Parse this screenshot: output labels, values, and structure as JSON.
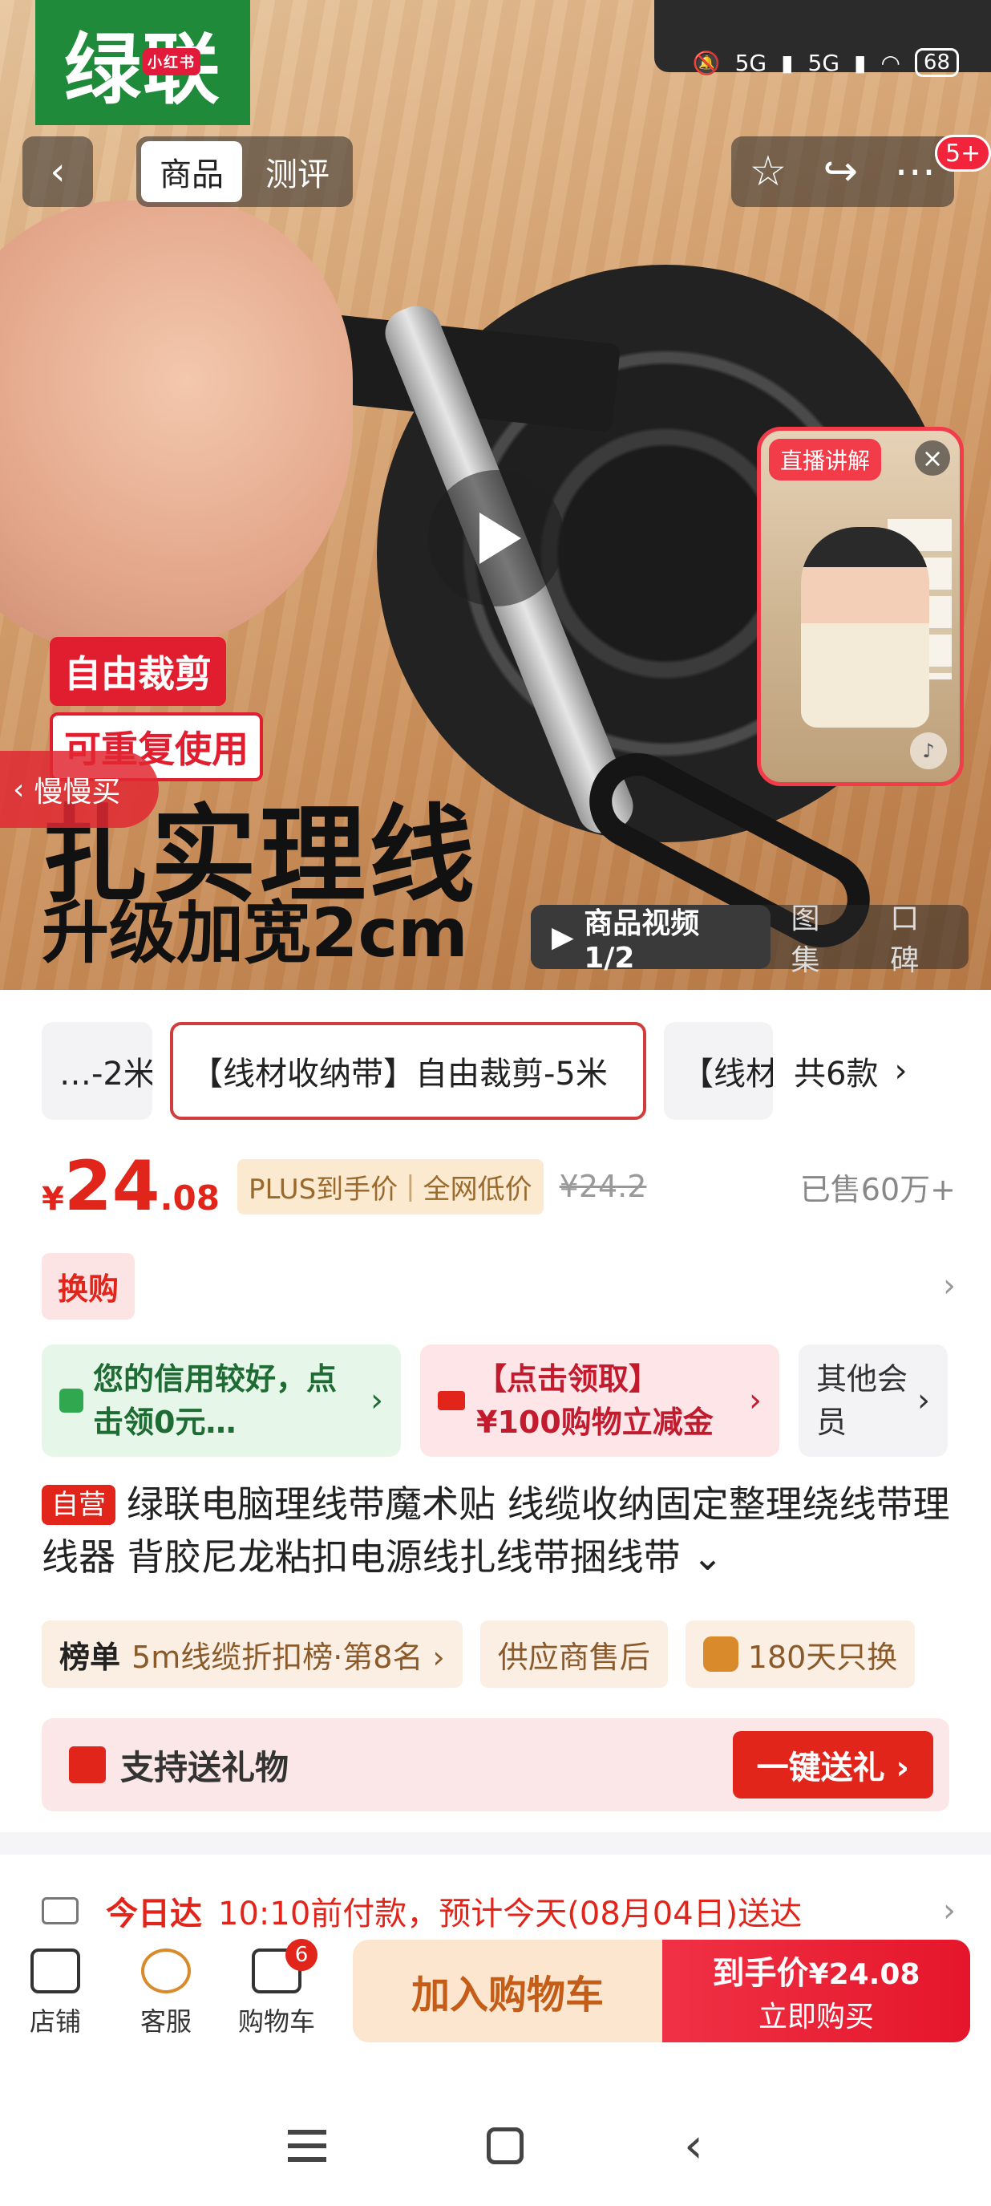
{
  "brand": {
    "logo_text": "绿联",
    "logo_sub": "小红书"
  },
  "status_bar": {
    "network1": "5G",
    "network2": "5G",
    "battery": "68"
  },
  "header": {
    "tabs": [
      {
        "label": "商品",
        "active": true
      },
      {
        "label": "测评",
        "active": false
      }
    ],
    "notification_count": "5+"
  },
  "hero": {
    "live_tag": "直播讲解",
    "promo_line1": "自由裁剪",
    "promo_line2": "可重复使用",
    "slow_buy": "慢慢买",
    "headline": "扎实理线",
    "subline": "升级加宽2cm",
    "media_tabs": [
      {
        "label": "商品视频1/2",
        "active": true
      },
      {
        "label": "图集",
        "active": false
      },
      {
        "label": "口碑",
        "active": false
      }
    ]
  },
  "sku": {
    "items": [
      "…-2米",
      "【线材收纳带】自由裁剪-5米",
      "【线材"
    ],
    "selected_index": 1,
    "more_label": "共6款"
  },
  "price": {
    "symbol": "¥",
    "integer": "24",
    "decimal": ".08",
    "plus_label": "PLUS到手价",
    "plus_sub": "全网低价",
    "original": "¥24.2",
    "sold": "已售60万+"
  },
  "swap": {
    "label": "换购"
  },
  "benefits": [
    {
      "text": "您的信用较好，点击领0元…",
      "color": "green"
    },
    {
      "text": "【点击领取】¥100购物立减金",
      "color": "red"
    },
    {
      "text": "其他会员",
      "color": "grey"
    }
  ],
  "product": {
    "self_tag": "自营",
    "title": "绿联电脑理线带魔术贴 线缆收纳固定整理绕线带理线器 背胶尼龙粘扣电源线扎线带捆线带"
  },
  "chips": [
    {
      "bold": "榜单",
      "text": "5m线缆折扣榜·第8名 ›"
    },
    {
      "bold": "",
      "text": "供应商售后"
    },
    {
      "bold": "",
      "text": "180天只换"
    }
  ],
  "gift": {
    "label": "支持送礼物",
    "button": "一键送礼 ›"
  },
  "delivery": {
    "today": "今日达",
    "message": "10:10前付款，预计今天(08月04日)送达"
  },
  "bottom_bar": {
    "store": "店铺",
    "service": "客服",
    "cart": "购物车",
    "cart_count": "6",
    "add_cart": "加入购物车",
    "buy_price_label": "到手价",
    "buy_price": "¥24.08",
    "buy_now": "立即购买"
  },
  "colors": {
    "accent": "#e1251b",
    "brand_green": "#1f8a3a"
  }
}
